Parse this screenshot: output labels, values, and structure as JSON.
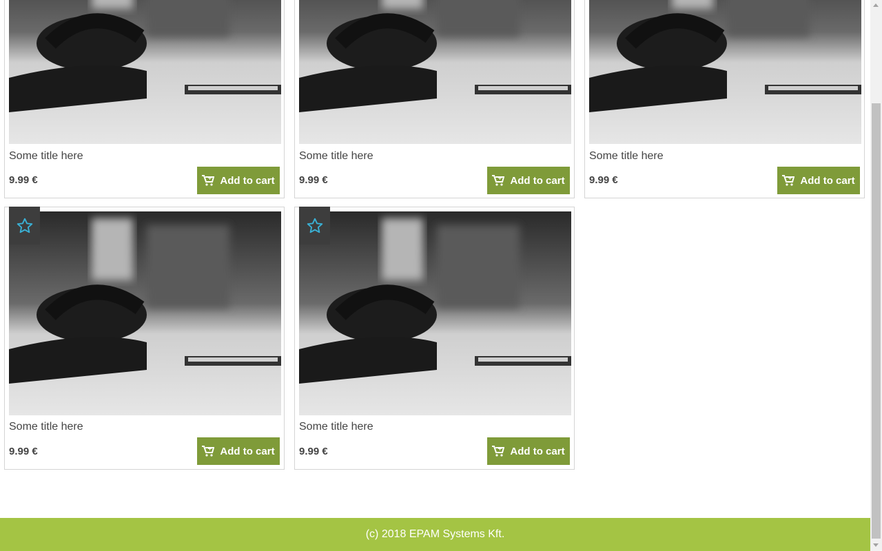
{
  "products": [
    {
      "title": "Some title here",
      "price": "9.99 €",
      "cart_label": "Add to cart",
      "favorite": false
    },
    {
      "title": "Some title here",
      "price": "9.99 €",
      "cart_label": "Add to cart",
      "favorite": false
    },
    {
      "title": "Some title here",
      "price": "9.99 €",
      "cart_label": "Add to cart",
      "favorite": false
    },
    {
      "title": "Some title here",
      "price": "9.99 €",
      "cart_label": "Add to cart",
      "favorite": true
    },
    {
      "title": "Some title here",
      "price": "9.99 €",
      "cart_label": "Add to cart",
      "favorite": true
    }
  ],
  "footer": {
    "text": "(c) 2018 EPAM Systems Kft."
  },
  "colors": {
    "cart_button": "#7f9b39",
    "footer": "#a4c444",
    "favorite_star": "#3ab0d4",
    "favorite_badge": "#3d3d3d"
  },
  "icons": {
    "favorite": "star-outline-icon",
    "cart": "shopping-cart-icon"
  }
}
